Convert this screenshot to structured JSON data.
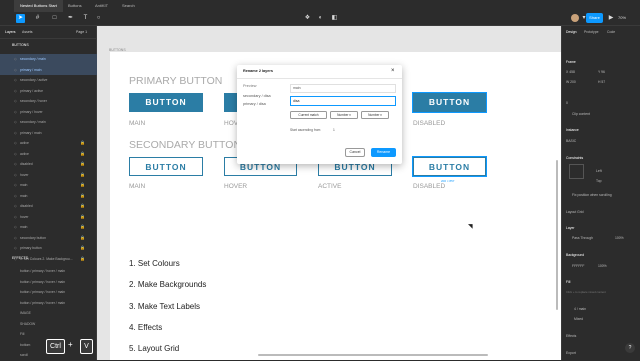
{
  "tabs": [
    "Nested Buttons Start",
    "Buttons",
    "AntiKIT",
    "Search"
  ],
  "topbar": {
    "share": "Share",
    "zoom": "70%"
  },
  "left": {
    "tab_layers": "Layers",
    "tab_assets": "Assets",
    "page": "Page 1",
    "section1": "BUTTONS",
    "section2": "EFFECTS",
    "layers": [
      "secondary / main",
      "primary / main",
      "secondary / active",
      "primary / active",
      "secondary / hover",
      "primary / hover",
      "secondary / main",
      "primary / main",
      "active",
      "active",
      "disabled",
      "hover",
      "main",
      "main",
      "disabled",
      "hover",
      "main",
      "secondary button",
      "primary button",
      "1. Set Colours 2. Make Backgrou..."
    ],
    "layers2": [
      "button / primary / hover / main",
      "button / primary / hover / main",
      "button / primary / hover / main",
      "button / primary / hover / main",
      "IMAGE",
      "SHADOW",
      "Fill",
      "bottom",
      "scroll"
    ]
  },
  "canvas": {
    "frame_label": "BUTTONS",
    "primary_heading": "PRIMARY BUTTON",
    "secondary_heading": "SECONDARY BUTTON",
    "btn": "BUTTON",
    "caps": [
      "MAIN",
      "HOVER",
      "ACTIVE",
      "DISABLED"
    ],
    "size_badge": "200 × 857",
    "steps": [
      "1. Set Colours",
      "2. Make Backgrounds",
      "3. Make Text Labels",
      "4. Effects",
      "5. Layout Grid"
    ]
  },
  "modal": {
    "title": "Rename 2 layers",
    "preview_label": "Preview",
    "preview1": "secondary / disa",
    "preview2": "primary / disa",
    "field1": "main",
    "field2": "disa",
    "current_match": "Current match",
    "number_label": "Number",
    "number2": "Number",
    "start_label": "Start ascending from",
    "start_val": "1",
    "cancel": "Cancel",
    "rename": "Rename"
  },
  "right": {
    "design": "Design",
    "prototype": "Prototype",
    "code": "Code",
    "frame": "Frame",
    "x": "X",
    "x_val": "458",
    "y": "Y",
    "y_val": "96",
    "w": "W",
    "w_val": "200",
    "h": "H",
    "h_val": "57",
    "r_val": "0",
    "clip": "Clip content",
    "instance": "Instance",
    "variant": "BASIC",
    "constraints": "Constraints",
    "left": "Left",
    "top": "Top",
    "fix_pos": "Fix position when scrolling",
    "layout_grid": "Layout Grid",
    "layer": "Layer",
    "pass": "Pass Through",
    "opacity": "100%",
    "background": "Background",
    "bg_val": "FFFFFF",
    "bg_op": "100%",
    "fill": "Fill",
    "fill_note": "Click + to replace mixed content",
    "stroke1": "4 / main",
    "stroke2": "Mixed",
    "effects": "Effects",
    "export": "Export"
  },
  "kbd": {
    "ctrl": "Ctrl",
    "plus": "+",
    "v": "V"
  }
}
